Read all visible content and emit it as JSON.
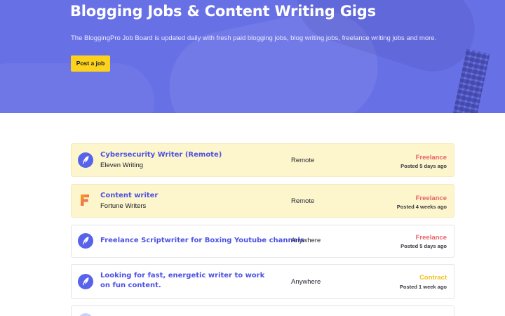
{
  "hero": {
    "title": "Blogging Jobs & Content Writing Gigs",
    "subtitle": "The BloggingPro Job Board is updated daily with fresh paid blogging jobs, blog writing jobs, freelance writing jobs and more.",
    "post_button": "Post a job"
  },
  "colors": {
    "hero_bg": "#6870e6",
    "accent": "#4b52e0",
    "button": "#fcd21c",
    "featured_bg": "#fdf5cb",
    "freelance": "#e8636a",
    "contract": "#f0c21c"
  },
  "jobs": [
    {
      "title": "Cybersecurity Writer (Remote)",
      "company": "Eleven Writing",
      "location": "Remote",
      "type": "Freelance",
      "posted": "Posted 5 days ago",
      "logo": "quill-icon"
    },
    {
      "title": "Content writer",
      "company": "Fortune Writers",
      "location": "Remote",
      "type": "Freelance",
      "posted": "Posted 4 weeks ago",
      "logo": "letter-f-logo"
    },
    {
      "title": "Freelance Scriptwriter for Boxing Youtube channels",
      "company": "",
      "location": "Anywhere",
      "type": "Freelance",
      "posted": "Posted 5 days ago",
      "logo": "quill-icon"
    },
    {
      "title": "Looking for fast, energetic writer to work on fun content.",
      "company": "",
      "location": "Anywhere",
      "type": "Contract",
      "posted": "Posted 1 week ago",
      "logo": "quill-icon"
    }
  ]
}
